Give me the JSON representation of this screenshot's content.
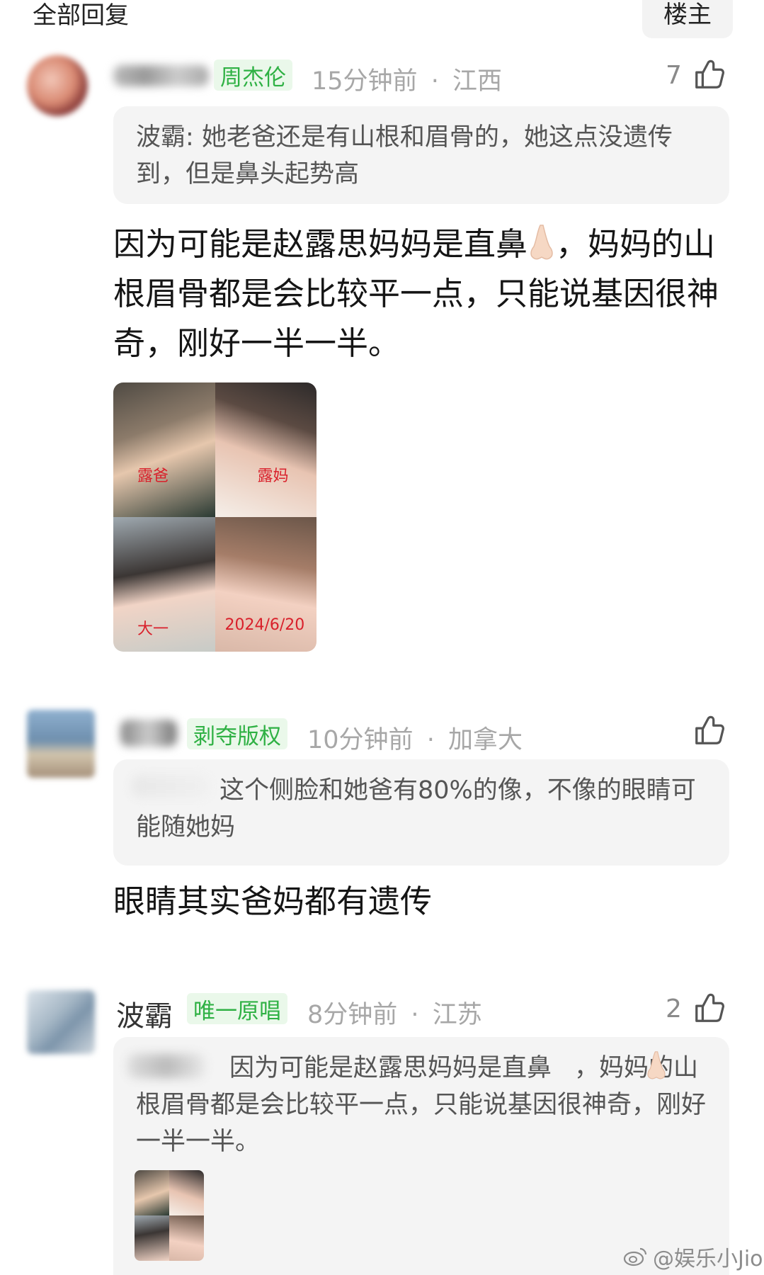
{
  "header": {
    "title": "全部回复",
    "op_button": "楼主"
  },
  "comments": [
    {
      "username": "",
      "badge": "周杰伦",
      "time": "15分钟前",
      "location": "江西",
      "likes": "7",
      "quote": "波霸: 她老爸还是有山根和眉骨的，她这点没遗传到，但是鼻头起势高",
      "body_part1": "因为可能是赵露思妈妈是直鼻",
      "body_part2": "，妈妈的山根眉骨都是会比较平一点，只能说基因很神奇，刚好一半一半。",
      "photo_labels": [
        "露爸",
        "露妈",
        "大一",
        "2024/6/20"
      ]
    },
    {
      "username": "",
      "badge": "剥夺版权",
      "time": "10分钟前",
      "location": "加拿大",
      "likes": "",
      "quote": "这个侧脸和她爸有80%的像，不像的眼睛可能随她妈",
      "body": "眼睛其实爸妈都有遗传"
    },
    {
      "username": "波霸",
      "badge": "唯一原唱",
      "time": "8分钟前",
      "location": "江苏",
      "likes": "2",
      "quote_part1": "因为可能是赵露思妈妈是直鼻",
      "quote_part2": "，妈妈的山根眉骨都是会比较平一点，只能说基因很神奇，刚好一半一半。"
    }
  ],
  "separator": "·",
  "watermark": "@娱乐小Jio",
  "colors": {
    "badge_bg": "#eaf8ea",
    "badge_text": "#2fb144",
    "meta": "#a7a7a7",
    "quote_bg": "#f4f4f4"
  },
  "icons": {
    "like": "thumbs-up-icon",
    "weibo": "weibo-icon",
    "emoji": "nose-emoji"
  }
}
